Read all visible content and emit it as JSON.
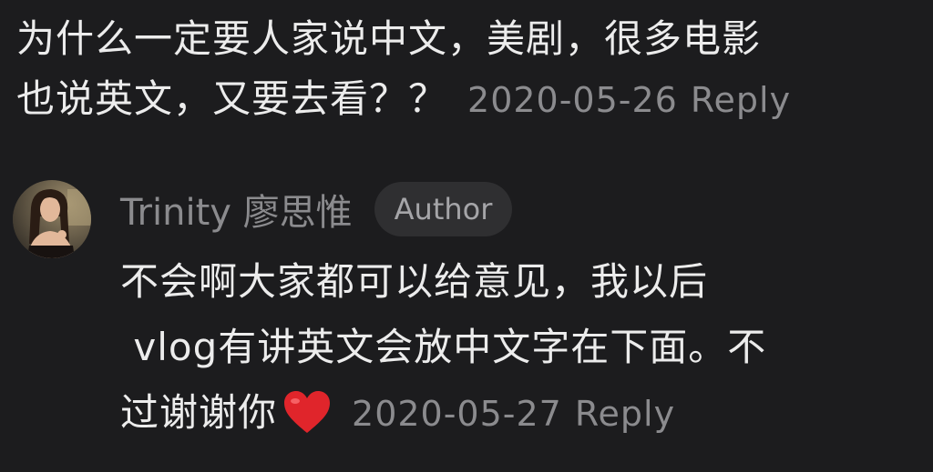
{
  "comment": {
    "text_line1": "为什么一定要人家说中文，美剧，很多电影",
    "text_line2": "也说英文，又要去看？？",
    "date": "2020-05-26",
    "reply_label": "Reply"
  },
  "reply": {
    "author": "Trinity 廖思惟",
    "badge": "Author",
    "text_line1": "不会啊大家都可以给意见，我以后",
    "text_line2": " vlog有讲英文会放中文字在下面。不",
    "text_line3": "过谢谢你",
    "emoji_icon": "red-heart-icon",
    "date": "2020-05-27",
    "reply_label": "Reply"
  },
  "colors": {
    "background": "#1c1c1e",
    "text_primary": "#ececec",
    "text_secondary": "#8b8b8e",
    "badge_bg": "#2f2f31",
    "heart": "#e0252b"
  }
}
